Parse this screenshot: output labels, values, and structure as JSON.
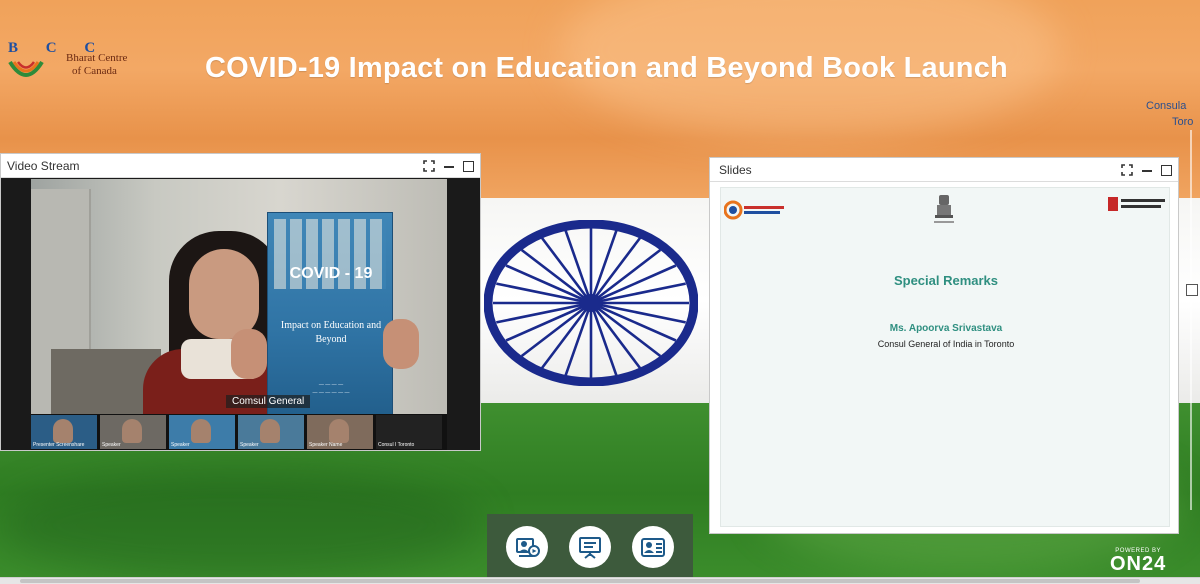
{
  "header": {
    "logo_letters": "B C C",
    "logo_name_line1": "Bharat Centre",
    "logo_name_line2": "of Canada",
    "title": "COVID-19 Impact on Education and Beyond Book Launch",
    "corner_line1": "Consula",
    "corner_line2": "Toro"
  },
  "video_widget": {
    "title": "Video Stream",
    "speaker_label": "Comsul General",
    "book_title": "COVID - 19",
    "book_subtitle": "Impact on Education and Beyond",
    "thumbnails": [
      {
        "caption": "Presenter Screenshare"
      },
      {
        "caption": "Speaker"
      },
      {
        "caption": "Speaker"
      },
      {
        "caption": "Speaker"
      },
      {
        "caption": "Speaker Name"
      },
      {
        "caption": "Consul I Toronto"
      }
    ]
  },
  "slides_widget": {
    "title": "Slides",
    "heading": "Special Remarks",
    "speaker_name": "Ms. Apoorva Srivastava",
    "speaker_role": "Consul General of India in Toronto",
    "logo_left_text": "BHARAT CENTRE OF CANADA",
    "logo_right_text": "UNIVERSITY CANADA WEST"
  },
  "dock": {
    "buttons": [
      {
        "icon": "media-player-icon"
      },
      {
        "icon": "slides-presentation-icon"
      },
      {
        "icon": "speaker-bio-icon"
      }
    ]
  },
  "footer": {
    "powered_by": "POWERED BY",
    "brand": "ON24"
  },
  "colors": {
    "saffron": "#f0a25a",
    "green": "#2f7d22",
    "chakra_blue": "#1a2a8c",
    "slide_teal": "#2f8f80"
  }
}
